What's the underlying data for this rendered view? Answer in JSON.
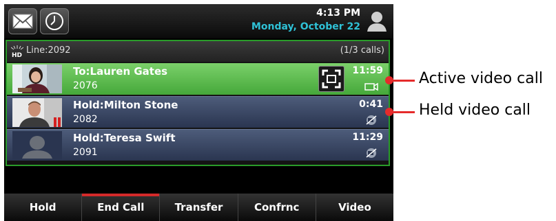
{
  "status_bar": {
    "time": "4:13 PM",
    "date": "Monday, October 22",
    "icons": [
      "mail-icon",
      "clock-icon",
      "user-icon"
    ]
  },
  "line": {
    "label": "Line:2092",
    "call_count": "(1/3 calls)"
  },
  "calls": [
    {
      "name": "To:Lauren Gates",
      "number": "2076",
      "duration": "11:59",
      "state": "active",
      "icon": "video-camera-icon"
    },
    {
      "name": "Hold:Milton Stone",
      "number": "2082",
      "duration": "0:41",
      "state": "hold",
      "icon": "video-off-icon"
    },
    {
      "name": "Hold:Teresa Swift",
      "number": "2091",
      "duration": "11:29",
      "state": "hold",
      "icon": "video-off-icon"
    }
  ],
  "softkeys": [
    "Hold",
    "End Call",
    "Transfer",
    "Confrnc",
    "Video"
  ],
  "callouts": {
    "active": "Active video call",
    "held": "Held video call"
  },
  "colors": {
    "active_row": "#45a83a",
    "hold_row": "#2a3550",
    "date": "#2fc1d6",
    "end_call_marker": "#d42a2a",
    "callout": "#e52b2b"
  }
}
